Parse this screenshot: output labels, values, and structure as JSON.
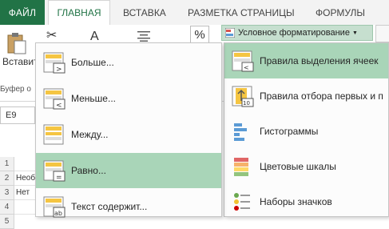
{
  "tabs": {
    "file": "ФАЙЛ",
    "home": "ГЛАВНАЯ",
    "insert": "ВСТАВКА",
    "page_layout": "РАЗМЕТКА СТРАНИЦЫ",
    "formulas": "ФОРМУЛЫ"
  },
  "ribbon": {
    "paste_label": "Вставит",
    "clipboard_group": "Буфер о",
    "percent_symbol": "%",
    "cond_format_label": "Условное форматирование"
  },
  "sheet": {
    "namebox_value": "E9",
    "rows": [
      "1",
      "2",
      "3",
      "4",
      "5"
    ],
    "cells": [
      "",
      "Необ",
      "Нет",
      "",
      ""
    ]
  },
  "cf_menu": {
    "items": [
      {
        "label": "Больше...",
        "icon": "greater-than-rule-icon",
        "highlighted": false
      },
      {
        "label": "Меньше...",
        "icon": "less-than-rule-icon",
        "highlighted": false
      },
      {
        "label": "Между...",
        "icon": "between-rule-icon",
        "highlighted": false
      },
      {
        "label": "Равно...",
        "icon": "equal-to-rule-icon",
        "highlighted": true
      },
      {
        "label": "Текст содержит...",
        "icon": "text-contains-rule-icon",
        "highlighted": false
      }
    ]
  },
  "main_menu": {
    "items": [
      {
        "label": "Правила выделения ячеек",
        "icon": "highlight-cells-rules-icon",
        "highlighted": true
      },
      {
        "label": "Правила отбора первых и п",
        "icon": "top-bottom-rules-icon",
        "highlighted": false
      },
      {
        "label": "Гистограммы",
        "icon": "data-bars-icon",
        "highlighted": false
      },
      {
        "label": "Цветовые шкалы",
        "icon": "color-scales-icon",
        "highlighted": false
      },
      {
        "label": "Наборы значков",
        "icon": "icon-sets-icon",
        "highlighted": false
      }
    ]
  },
  "colors": {
    "file_tab": "#217346",
    "highlight": "#a9d5b8",
    "cf_button": "#c6dfcf"
  }
}
